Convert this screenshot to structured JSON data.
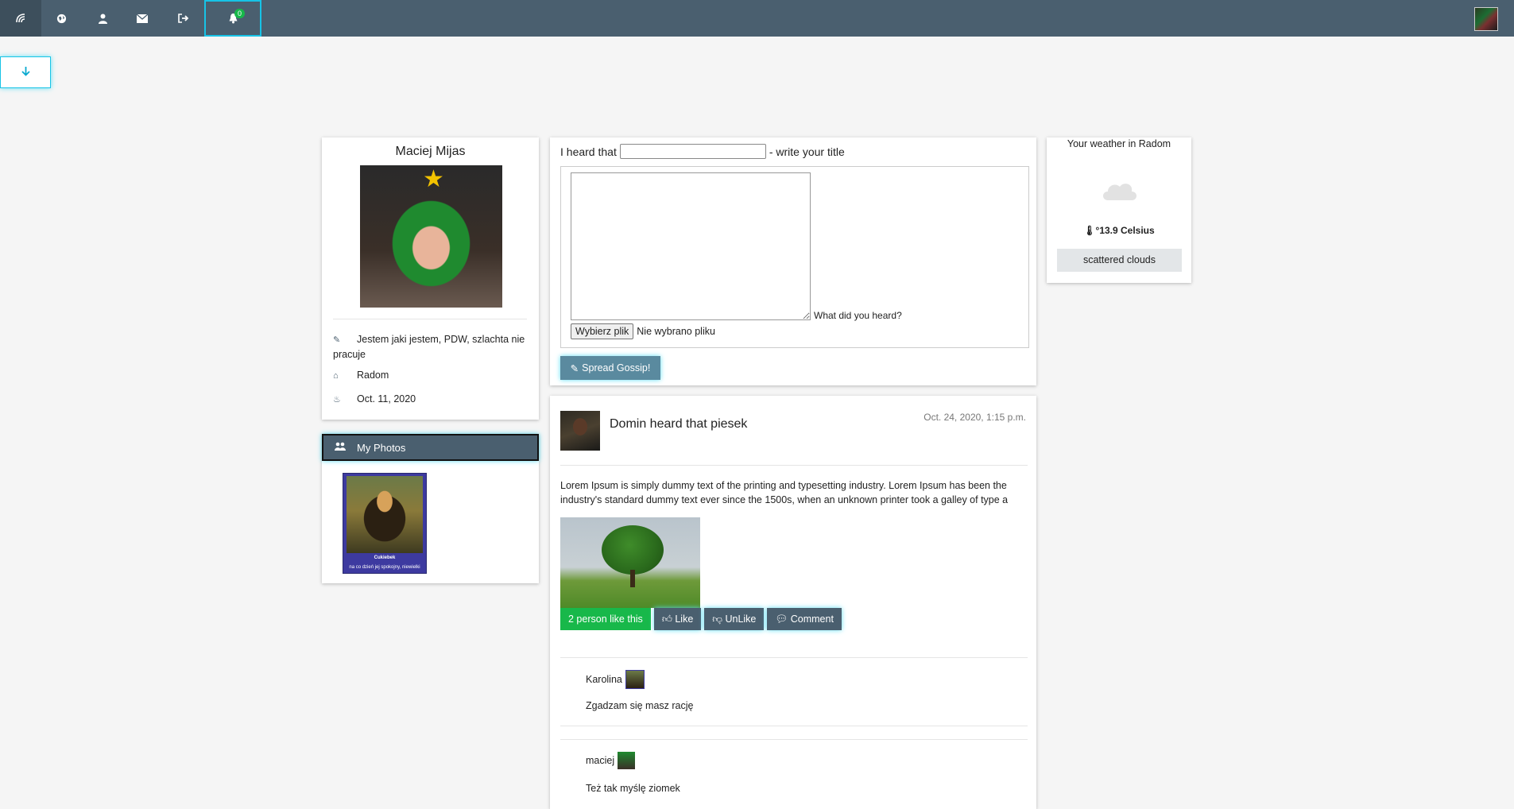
{
  "nav": {
    "notification_count": "0",
    "items": [
      "home",
      "globe",
      "profile",
      "messages",
      "logout",
      "notifications"
    ]
  },
  "colors": {
    "navbar": "#4a5f6f",
    "accent_glow": "#17c3e6",
    "like_green": "#18b84a"
  },
  "profile": {
    "name": "Maciej Mijas",
    "bio": "Jestem jaki jestem, PDW, szlachta nie pracuje",
    "city": "Radom",
    "birthday": "Oct. 11, 2020"
  },
  "photos": {
    "header": "My Photos",
    "caption_title": "Cukiebek",
    "caption_sub": "na co dzień jej spokojny, niewielki"
  },
  "post_form": {
    "prefix": "I heard that",
    "title_value": "",
    "suffix": "- write your title",
    "body_hint": "What did you heard?",
    "file_button": "Wybierz plik",
    "file_status": "Nie wybrano pliku",
    "submit": "Spread Gossip!"
  },
  "weather": {
    "title": "Your weather in Radom",
    "temperature": "°13.9 Celsius",
    "description": "scattered clouds",
    "icon": "cloud-icon"
  },
  "post": {
    "title": "Domin heard that piesek",
    "date": "Oct. 24, 2020, 1:15 p.m.",
    "body": "Lorem Ipsum is simply dummy text of the printing and typesetting industry. Lorem Ipsum has been the industry's standard dummy text ever since the 1500s, when an unknown printer took a galley of type a",
    "likes": "2 person like this",
    "like": "Like",
    "unlike": "UnLike",
    "comment": "Comment"
  },
  "comments": [
    {
      "author": "Karolina",
      "text": "Zgadzam się masz rację"
    },
    {
      "author": "maciej",
      "text": "Też tak myślę ziomek"
    }
  ]
}
